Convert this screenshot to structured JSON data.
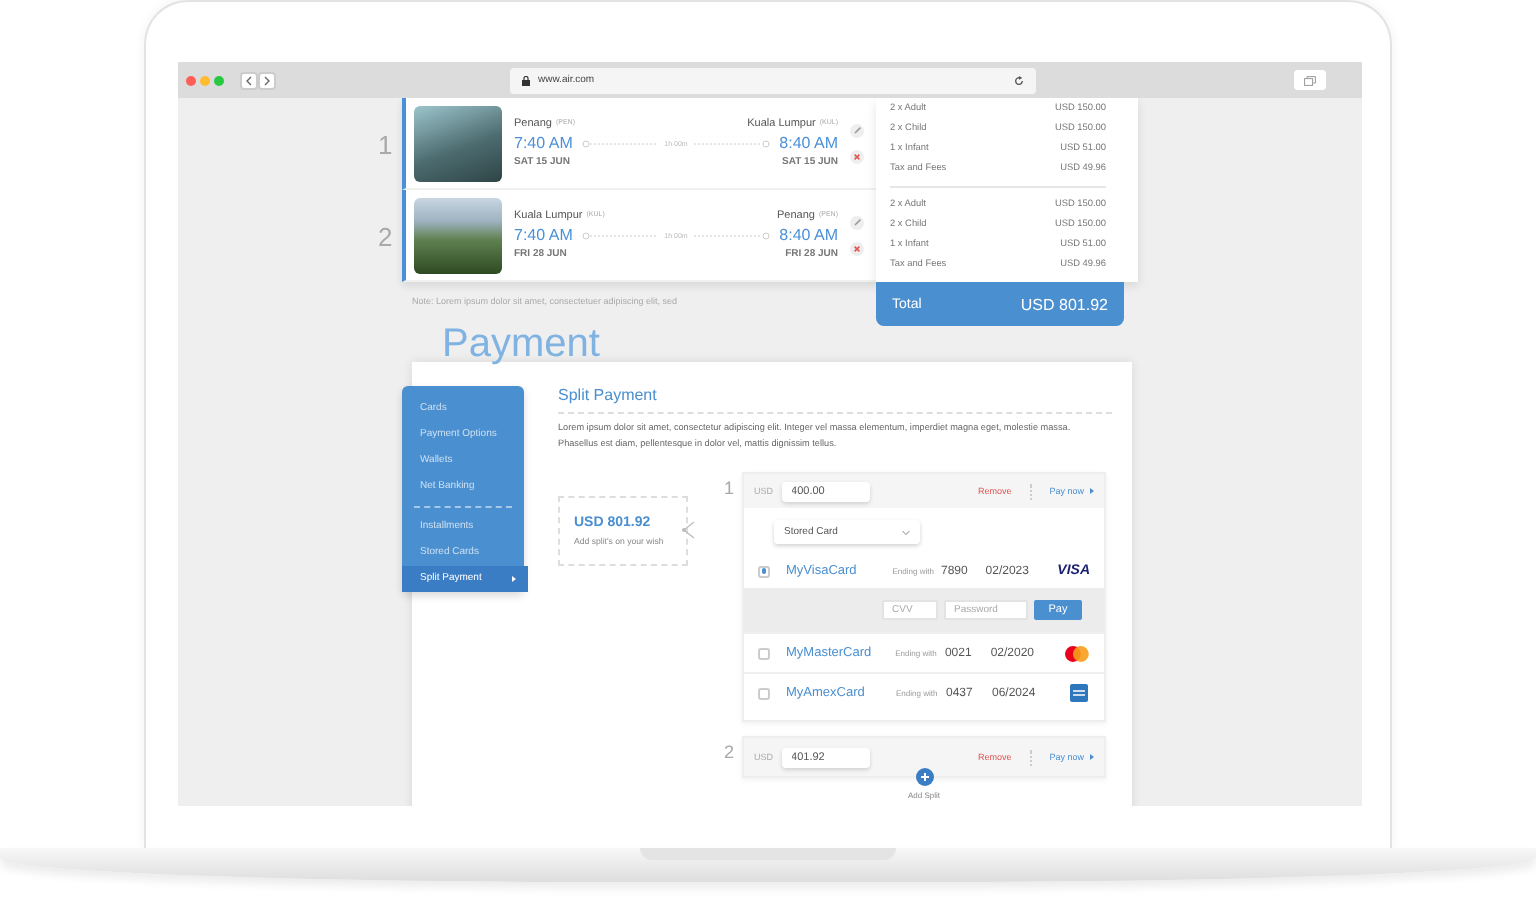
{
  "browser": {
    "url": "www.air.com"
  },
  "flights": [
    {
      "index": "1",
      "from": {
        "city": "Penang",
        "code": "(PEN)",
        "time": "7:40 AM",
        "date": "SAT 15 JUN"
      },
      "duration": "1h 00m",
      "to": {
        "city": "Kuala Lumpur",
        "code": "(KUL)",
        "time": "8:40 AM",
        "date": "SAT 15 JUN"
      }
    },
    {
      "index": "2",
      "from": {
        "city": "Kuala Lumpur",
        "code": "(KUL)",
        "time": "7:40 AM",
        "date": "FRI 28 JUN"
      },
      "duration": "1h 00m",
      "to": {
        "city": "Penang",
        "code": "(PEN)",
        "time": "8:40 AM",
        "date": "FRI 28 JUN"
      }
    }
  ],
  "price_summary": {
    "groups": [
      [
        {
          "label": "2 x Adult",
          "amount": "USD 150.00"
        },
        {
          "label": "2 x Child",
          "amount": "USD 150.00"
        },
        {
          "label": "1 x Infant",
          "amount": "USD 51.00"
        },
        {
          "label": "Tax and Fees",
          "amount": "USD 49.96"
        }
      ],
      [
        {
          "label": "2 x Adult",
          "amount": "USD 150.00"
        },
        {
          "label": "2 x Child",
          "amount": "USD 150.00"
        },
        {
          "label": "1 x Infant",
          "amount": "USD 51.00"
        },
        {
          "label": "Tax and Fees",
          "amount": "USD 49.96"
        }
      ]
    ],
    "total": {
      "label": "Total",
      "amount": "USD 801.92"
    }
  },
  "note": "Note: Lorem ipsum dolor sit amet, consectetuer adipiscing elit, sed",
  "heading": "Payment",
  "sidebar": {
    "groups": [
      [
        {
          "label": "Cards",
          "selected": false
        },
        {
          "label": "Payment Options",
          "selected": false
        },
        {
          "label": "Wallets",
          "selected": false
        },
        {
          "label": "Net Banking",
          "selected": false
        }
      ],
      [
        {
          "label": "Installments",
          "selected": false
        },
        {
          "label": "Stored Cards",
          "selected": false
        },
        {
          "label": "Split Payment",
          "selected": true
        }
      ]
    ]
  },
  "split_payment": {
    "title": "Split Payment",
    "description": "Lorem ipsum dolor sit amet, consectetur adipiscing elit. Integer vel massa elementum, imperdiet magna eget, molestie massa. Phasellus est diam, pellentesque in dolor vel, mattis dignissim tellus.",
    "summary": {
      "amount": "USD 801.92",
      "caption": "Add split's on your wish"
    },
    "splits": [
      {
        "index": "1",
        "currency": "USD",
        "amount": "400.00",
        "remove": "Remove",
        "pay": "Pay now",
        "method": "Stored Card",
        "cards": [
          {
            "name": "MyVisaCard",
            "ending_label": "Ending with",
            "ending": "7890",
            "expiry": "02/2023",
            "kind": "visa",
            "logo_text": "VISA",
            "selected": true
          },
          {
            "name": "MyMasterCard",
            "ending_label": "Ending with",
            "ending": "0021",
            "expiry": "02/2020",
            "kind": "mastercard",
            "selected": false
          },
          {
            "name": "MyAmexCard",
            "ending_label": "Ending with",
            "ending": "0437",
            "expiry": "06/2024",
            "kind": "amex",
            "selected": false
          }
        ],
        "cvv_placeholder": "CVV",
        "password_placeholder": "Password",
        "pay_button": "Pay"
      },
      {
        "index": "2",
        "currency": "USD",
        "amount": "401.92",
        "remove": "Remove",
        "pay": "Pay now"
      }
    ],
    "add_split": "Add Split"
  }
}
